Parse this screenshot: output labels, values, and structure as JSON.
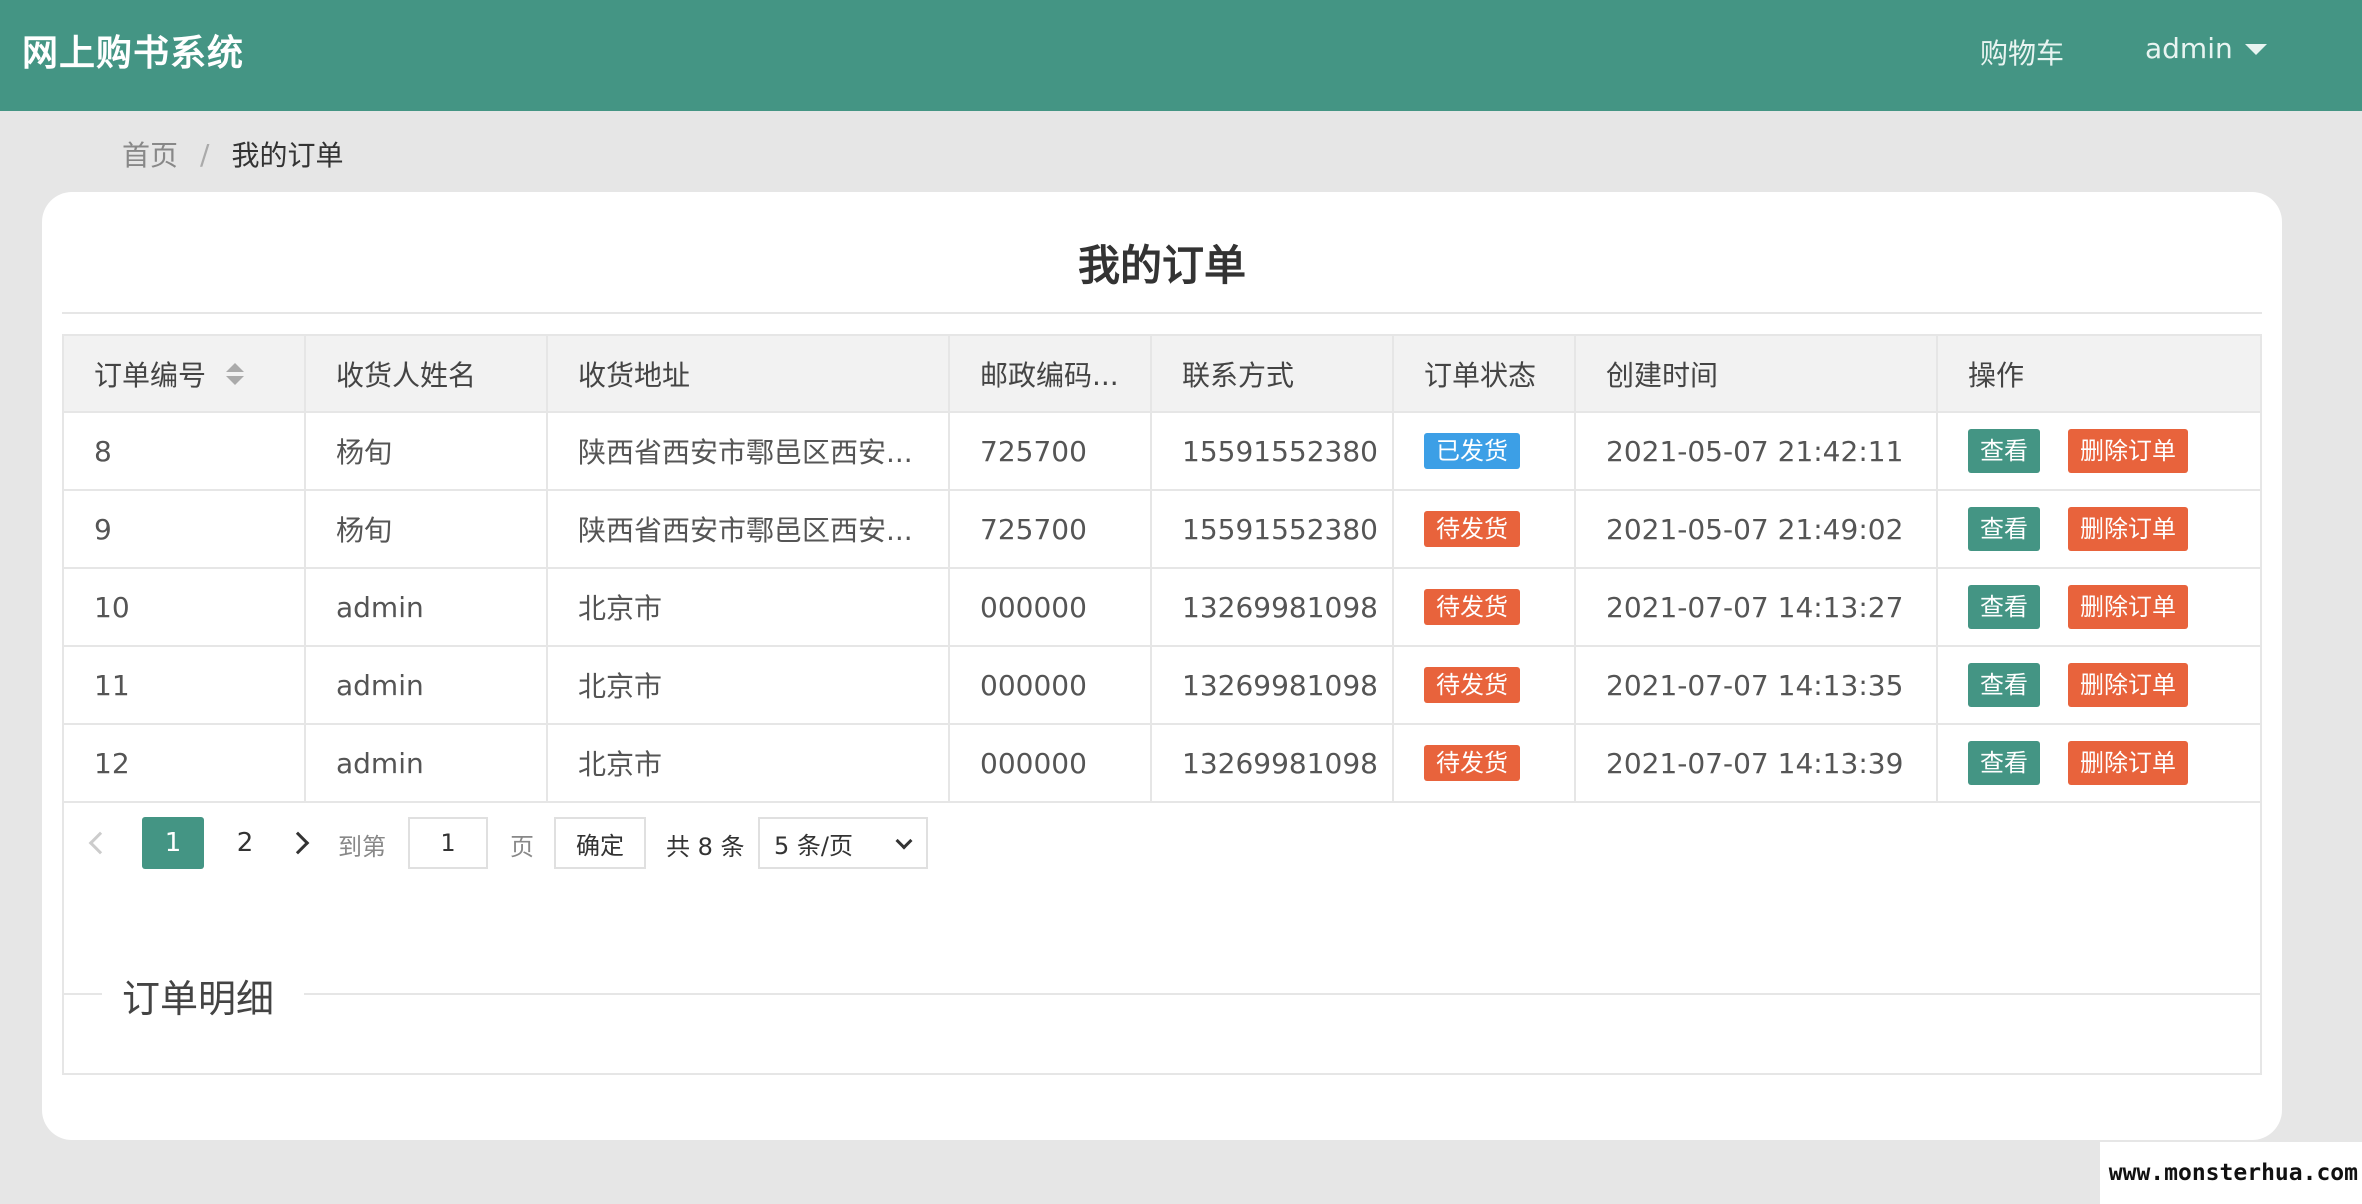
{
  "app": {
    "brand": "网上购书系统",
    "nav_cart": "购物车",
    "nav_user": "admin"
  },
  "breadcrumb": {
    "home": "首页",
    "separator": "/",
    "current": "我的订单"
  },
  "page_title": "我的订单",
  "table": {
    "headers": [
      "订单编号",
      "收货人姓名",
      "收货地址",
      "邮政编码...",
      "联系方式",
      "订单状态",
      "创建时间",
      "操作"
    ],
    "rows": [
      {
        "id": "8",
        "name": "杨旬",
        "address": "陕西省西安市鄠邑区西安...",
        "postcode": "725700",
        "phone": "15591552380",
        "status": "已发货",
        "created": "2021-05-07 21:42:11"
      },
      {
        "id": "9",
        "name": "杨旬",
        "address": "陕西省西安市鄠邑区西安...",
        "postcode": "725700",
        "phone": "15591552380",
        "status": "待发货",
        "created": "2021-05-07 21:49:02"
      },
      {
        "id": "10",
        "name": "admin",
        "address": "北京市",
        "postcode": "000000",
        "phone": "13269981098",
        "status": "待发货",
        "created": "2021-07-07 14:13:27"
      },
      {
        "id": "11",
        "name": "admin",
        "address": "北京市",
        "postcode": "000000",
        "phone": "13269981098",
        "status": "待发货",
        "created": "2021-07-07 14:13:35"
      },
      {
        "id": "12",
        "name": "admin",
        "address": "北京市",
        "postcode": "000000",
        "phone": "13269981098",
        "status": "待发货",
        "created": "2021-07-07 14:13:39"
      }
    ],
    "view_label": "查看",
    "delete_label": "删除订单"
  },
  "status_colors": {
    "已发货": "#3c9fe6",
    "待发货": "#e8633c"
  },
  "pagination": {
    "current_page": "1",
    "page_2": "2",
    "goto_label": "到第",
    "goto_value": "1",
    "page_label": "页",
    "confirm_label": "确定",
    "total_label": "共 8 条",
    "page_size": "5 条/页"
  },
  "detail": {
    "title": "订单明细"
  },
  "watermark": "www.monsterhua.com",
  "icons": {
    "sort": "sort-icon",
    "caret": "caret-down-icon",
    "prev": "chevron-left-icon",
    "next": "chevron-right-icon",
    "dropdown": "chevron-down-icon"
  },
  "colors": {
    "primary": "#449584",
    "danger": "#e8633c",
    "info": "#3c9fe6"
  }
}
